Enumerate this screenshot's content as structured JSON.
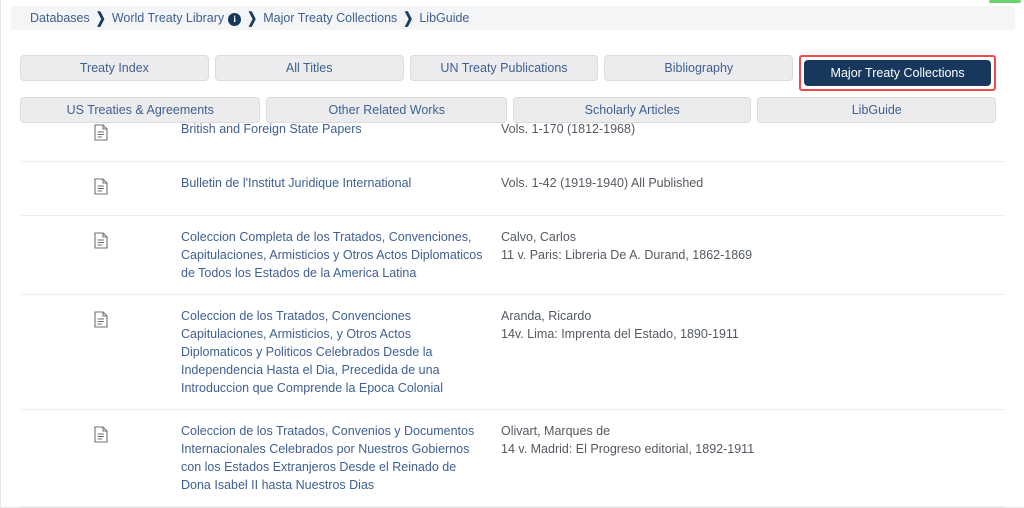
{
  "progress": {
    "name": "page-load-progress",
    "percent": 97,
    "color": "#67d36a"
  },
  "breadcrumb": {
    "separator": "❯",
    "info_glyph": "i",
    "items": [
      {
        "label": "Databases",
        "has_info": false
      },
      {
        "label": "World Treaty Library",
        "has_info": true
      },
      {
        "label": "Major Treaty Collections",
        "has_info": false
      },
      {
        "label": "LibGuide",
        "has_info": false
      }
    ]
  },
  "tabs": {
    "row1": [
      {
        "label": "Treaty Index",
        "active": false,
        "highlighted": false
      },
      {
        "label": "All Titles",
        "active": false,
        "highlighted": false
      },
      {
        "label": "UN Treaty Publications",
        "active": false,
        "highlighted": false
      },
      {
        "label": "Bibliography",
        "active": false,
        "highlighted": false
      },
      {
        "label": "Major Treaty Collections",
        "active": true,
        "highlighted": true
      }
    ],
    "row2": [
      {
        "label": "US Treaties & Agreements",
        "active": false,
        "highlighted": false
      },
      {
        "label": "Other Related Works",
        "active": false,
        "highlighted": false
      },
      {
        "label": "Scholarly Articles",
        "active": false,
        "highlighted": false
      },
      {
        "label": "LibGuide",
        "active": false,
        "highlighted": false
      }
    ],
    "highlight_color": "#f2494a",
    "active_color": "#17385c"
  },
  "results": {
    "icon_name": "document-icon",
    "rows": [
      {
        "title": "British and Foreign State Papers",
        "meta1": "Vols. 1-170 (1812-1968)",
        "meta2": ""
      },
      {
        "title": "Bulletin de l'Institut Juridique International",
        "meta1": "Vols. 1-42 (1919-1940) All Published",
        "meta2": ""
      },
      {
        "title": "Coleccion Completa de los Tratados, Convenciones, Capitulaciones, Armisticios y Otros Actos Diplomaticos de Todos los Estados de la America Latina",
        "meta1": "Calvo, Carlos",
        "meta2": "11 v. Paris: Libreria De A. Durand, 1862-1869"
      },
      {
        "title": "Coleccion de los Tratados, Convenciones Capitulaciones, Armisticios, y Otros Actos Diplomaticos y Politicos Celebrados Desde la Independencia Hasta el Dia, Precedida de una Introduccion que Comprende la Epoca Colonial",
        "meta1": "Aranda, Ricardo",
        "meta2": "14v. Lima: Imprenta del Estado, 1890-1911"
      },
      {
        "title": "Coleccion de los Tratados, Convenios y Documentos Internacionales Celebrados por Nuestros Gobiernos con los Estados Extranjeros Desde el Reinado de Dona Isabel II hasta Nuestros Dias",
        "meta1": "Olivart, Marques de",
        "meta2": "14 v. Madrid: El Progreso editorial, 1892-1911"
      }
    ]
  }
}
